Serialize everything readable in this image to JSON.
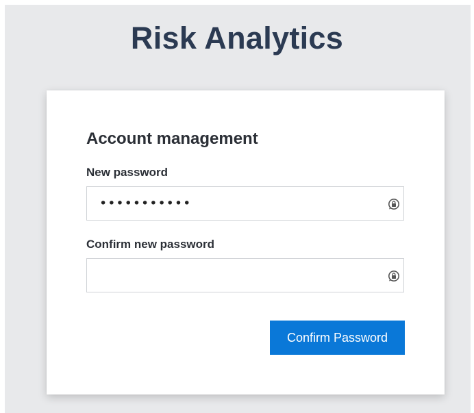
{
  "app": {
    "title": "Risk Analytics"
  },
  "form": {
    "heading": "Account management",
    "new_password": {
      "label": "New password",
      "value": "...........",
      "icon": "password-manager-lock-icon"
    },
    "confirm_password": {
      "label": "Confirm new password",
      "value": "",
      "icon": "password-manager-lock-icon"
    },
    "submit_label": "Confirm Password"
  },
  "colors": {
    "page_background": "#e8e9eb",
    "title": "#2b3a52",
    "button": "#0a78d8"
  }
}
